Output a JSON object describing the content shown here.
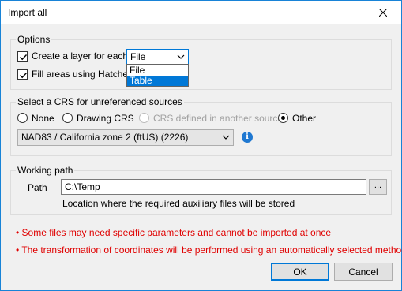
{
  "window": {
    "title": "Import all"
  },
  "options": {
    "legend": "Options",
    "create_layer_label": "Create a layer for each",
    "create_layer_checked": true,
    "layer_mode_value": "File",
    "layer_mode_options": [
      "File",
      "Table"
    ],
    "layer_mode_highlighted": "Table",
    "fill_areas_label": "Fill areas using Hatches",
    "fill_areas_checked": true
  },
  "crs": {
    "legend": "Select a CRS for unreferenced sources",
    "radios": [
      {
        "label": "None",
        "selected": false,
        "enabled": true
      },
      {
        "label": "Drawing CRS",
        "selected": false,
        "enabled": true
      },
      {
        "label": "CRS defined in another source",
        "selected": false,
        "enabled": false
      },
      {
        "label": "Other",
        "selected": true,
        "enabled": true
      }
    ],
    "selected_crs": "NAD83 / California zone 2 (ftUS) (2226)",
    "info_glyph": "i"
  },
  "working_path": {
    "legend": "Working path",
    "path_label": "Path",
    "path_value": "C:\\Temp",
    "browse_label": "...",
    "hint": "Location where the required auxiliary files will be stored"
  },
  "notes": [
    "• Some files may need specific parameters and cannot be imported at once",
    "• The transformation of coordinates will be performed using an automatically selected method"
  ],
  "buttons": {
    "ok": "OK",
    "cancel": "Cancel"
  },
  "colors": {
    "accent": "#0078d7",
    "note_red": "#e00000",
    "info_blue": "#1f78d1"
  }
}
